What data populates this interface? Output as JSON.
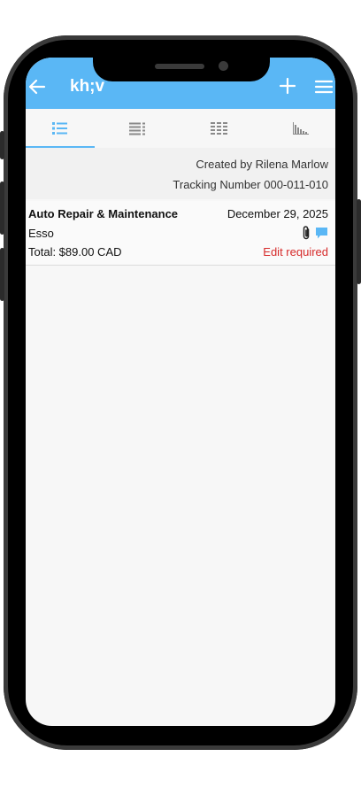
{
  "app": {
    "title": "kh;v"
  },
  "tabs": [
    {
      "name": "list-view-icon",
      "active": true
    },
    {
      "name": "detail-list-icon",
      "active": false
    },
    {
      "name": "grid-view-icon",
      "active": false
    },
    {
      "name": "chart-icon",
      "active": false
    }
  ],
  "report": {
    "created_by": "Created by Rilena Marlow",
    "tracking_number": "Tracking Number 000-011-010"
  },
  "expenses": [
    {
      "category": "Auto Repair & Maintenance",
      "date": "December 29, 2025",
      "merchant": "Esso",
      "total": "Total: $89.00 CAD",
      "status": "Edit required",
      "has_attachment": true,
      "has_comment": true
    }
  ],
  "colors": {
    "accent": "#5ab7f5",
    "status_error": "#d62a2a"
  }
}
